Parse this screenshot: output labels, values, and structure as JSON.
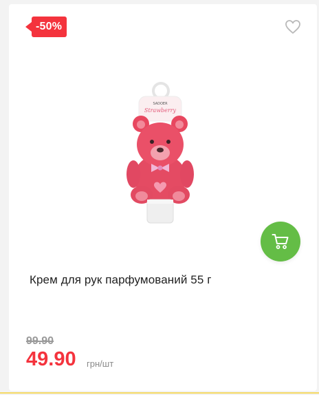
{
  "badge": {
    "discount": "-50%"
  },
  "product": {
    "title": "Крем для рук парфумований 55 г",
    "image_brand": "SADOER",
    "image_flavor": "Strawberry"
  },
  "price": {
    "old": "99.90",
    "current": "49.90",
    "unit": "грн/шт"
  },
  "icons": {
    "favorite": "heart-outline-icon",
    "cart": "shopping-cart-icon"
  },
  "colors": {
    "badge": "#f4333d",
    "price": "#f4333d",
    "cart_button": "#64bd46"
  }
}
